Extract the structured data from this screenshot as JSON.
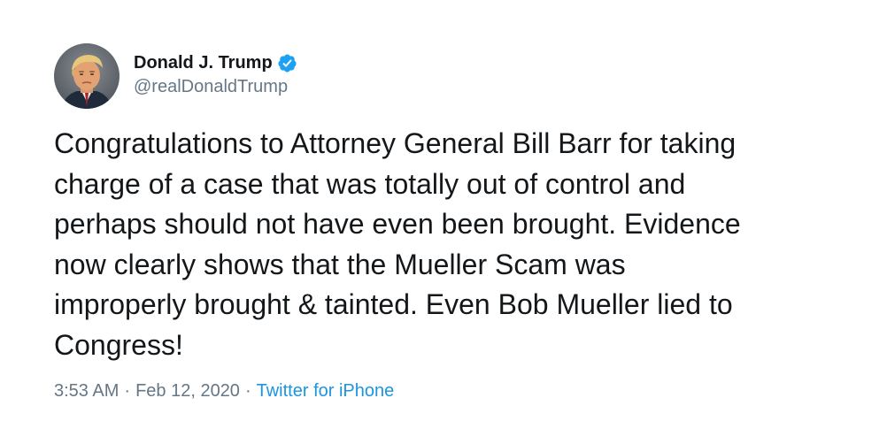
{
  "author": {
    "display_name": "Donald J. Trump",
    "handle": "@realDonaldTrump",
    "verified": true,
    "verified_color": "#1da1f2"
  },
  "tweet": {
    "text": "Congratulations to Attorney General Bill Barr for taking\ncharge of a case that was totally out of control and\nperhaps should not have even been brought. Evidence\nnow clearly shows that the Mueller Scam was\nimproperly brought & tainted. Even Bob Mueller lied to\nCongress!"
  },
  "meta": {
    "time": "3:53 AM",
    "separator": "·",
    "date": "Feb 12, 2020",
    "source": "Twitter for iPhone",
    "link_color": "#1b95e0"
  }
}
